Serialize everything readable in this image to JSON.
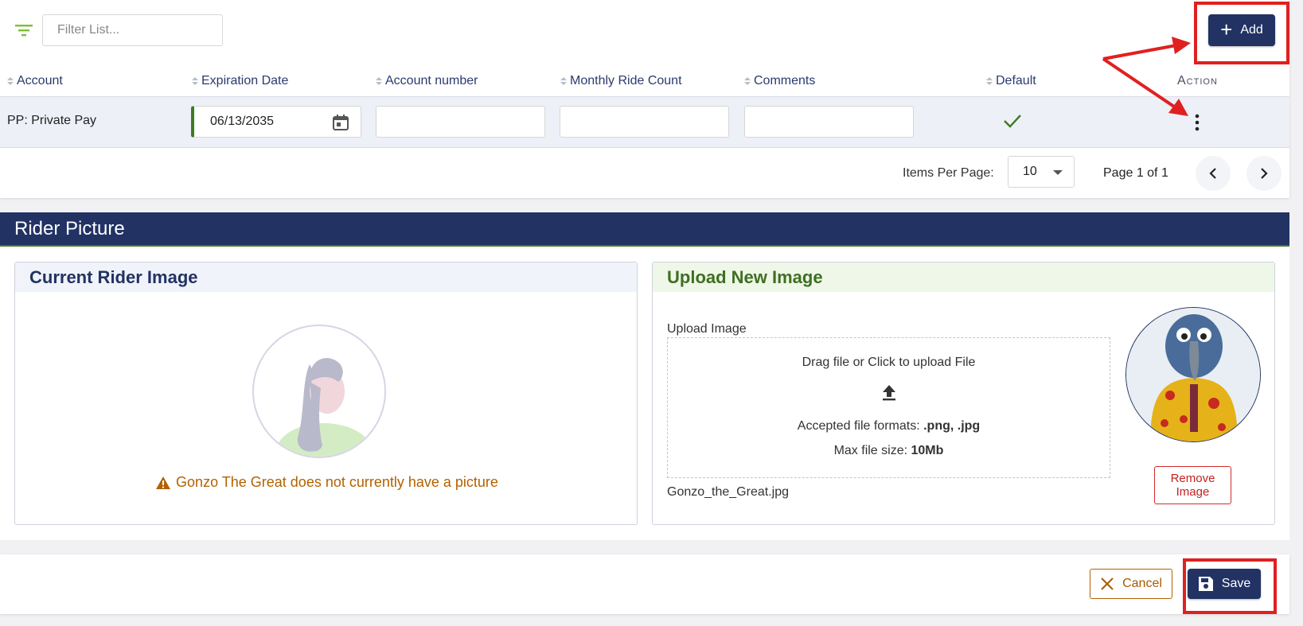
{
  "toolbar": {
    "filter_placeholder": "Filter List...",
    "add_label": "Add"
  },
  "table": {
    "columns": [
      "Account",
      "Expiration Date",
      "Account number",
      "Monthly Ride Count",
      "Comments",
      "Default",
      "Action"
    ],
    "rows": [
      {
        "account": "PP: Private Pay",
        "expiration_date": "06/13/2035",
        "account_number": "",
        "monthly_ride_count": "",
        "comments": "",
        "default": true
      }
    ]
  },
  "pagination": {
    "items_per_page_label": "Items Per Page:",
    "items_per_page": "10",
    "page_info": "Page 1 of 1"
  },
  "rider_picture": {
    "section_title": "Rider Picture",
    "current_title": "Current Rider Image",
    "no_picture_message": "Gonzo The Great does not currently have a picture",
    "upload_title": "Upload New Image",
    "upload_label": "Upload Image",
    "dropzone_text": "Drag file or Click to upload File",
    "accepted_formats_label": "Accepted file formats:",
    "accepted_formats": ".png, .jpg",
    "max_size_label": "Max file size:",
    "max_size": "10Mb",
    "file_name": "Gonzo_the_Great.jpg",
    "remove_label_line1": "Remove",
    "remove_label_line2": "Image"
  },
  "footer": {
    "cancel_label": "Cancel",
    "save_label": "Save"
  },
  "colors": {
    "primary": "#223263",
    "accent_green": "#3f7a22",
    "warning": "#b36200",
    "danger": "#d32a2a",
    "annotation": "#e02020"
  }
}
